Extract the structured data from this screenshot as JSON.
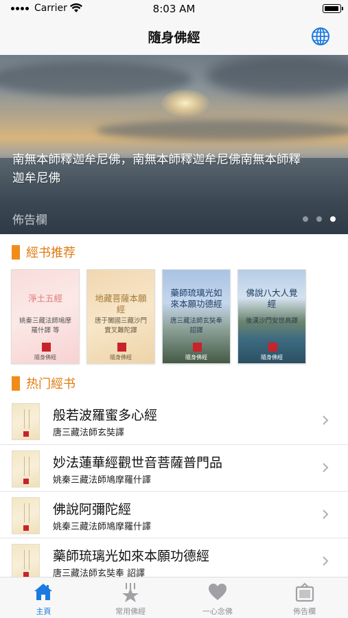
{
  "status_bar": {
    "carrier": "Carrier",
    "time": "8:03 AM"
  },
  "nav": {
    "title": "隨身佛經",
    "right_icon": "globe-icon"
  },
  "banner": {
    "text": "南無本師釋迦牟尼佛，南無本師釋迦牟尼佛南無本師釋迦牟尼佛",
    "label": "佈告欄",
    "pages": 3,
    "active_page": 3
  },
  "recommended": {
    "title": "經书推荐",
    "books": [
      {
        "title": "淨土五經",
        "subtitle": "姚秦三藏法師鳩摩羅什譯 等",
        "brand": "隨身佛經"
      },
      {
        "title": "地藏菩薩本願經",
        "subtitle": "唐于闐國三藏沙門實叉難陀譯",
        "brand": "隨身佛經"
      },
      {
        "title": "藥師琉璃光如來本願功德經",
        "subtitle": "唐三藏法師玄奘奉 詔譯",
        "brand": "隨身佛經"
      },
      {
        "title": "佛說八大人覺經",
        "subtitle": "後漢沙門安世高譯",
        "brand": "隨身佛經"
      }
    ]
  },
  "popular": {
    "title": "热门經书",
    "items": [
      {
        "title": "般若波羅蜜多心經",
        "subtitle": "唐三藏法師玄奘譯"
      },
      {
        "title": "妙法蓮華經觀世音菩薩普門品",
        "subtitle": "姚秦三藏法師鳩摩羅什譯"
      },
      {
        "title": "佛說阿彌陀經",
        "subtitle": "姚秦三藏法師鳩摩羅什譯"
      },
      {
        "title": "藥師琉璃光如來本願功德經",
        "subtitle": "唐三藏法師玄奘奉 詔譯"
      }
    ]
  },
  "tabs": [
    {
      "label": "主頁",
      "icon": "home-icon",
      "active": true
    },
    {
      "label": "常用佛經",
      "icon": "star-icon",
      "active": false
    },
    {
      "label": "一心念佛",
      "icon": "heart-icon",
      "active": false
    },
    {
      "label": "佈告欄",
      "icon": "board-icon",
      "active": false
    }
  ],
  "colors": {
    "accent": "#f08c19",
    "active_tab": "#1a7ae0",
    "inactive_tab": "#8e8e93"
  }
}
